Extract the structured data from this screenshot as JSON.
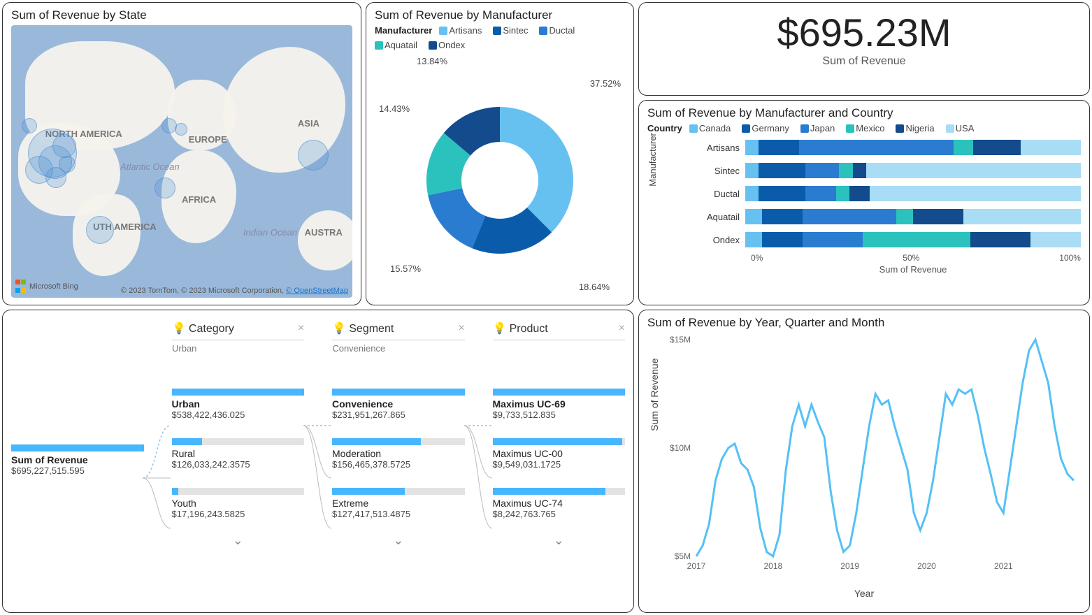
{
  "colors": {
    "c1": "#66c1f0",
    "c2": "#0a5cab",
    "c3": "#2a7cd0",
    "c4": "#2bc2bd",
    "c5": "#134b8c",
    "c6": "#a9dcf5",
    "line": "#55c1f5",
    "bar_bg": "#e3e3e3",
    "bar_fill": "#46b6ff"
  },
  "map": {
    "title": "Sum of Revenue by State",
    "labels": {
      "na": "NORTH AMERICA",
      "sa": "UTH AMERICA",
      "eu": "EUROPE",
      "af": "AFRICA",
      "as": "ASIA",
      "au": "AUSTRA",
      "ao": "Atlantic Ocean",
      "io": "Indian Ocean"
    },
    "attribution_left": "Microsoft Bing",
    "attribution_right": "© 2023 TomTom, © 2023 Microsoft Corporation, ",
    "attribution_link": "© OpenStreetMap"
  },
  "donut": {
    "title": "Sum of Revenue by Manufacturer",
    "legend_label": "Manufacturer",
    "items": [
      "Artisans",
      "Sintec",
      "Ductal",
      "Aquatail",
      "Ondex"
    ],
    "labels": [
      "37.52%",
      "18.64%",
      "15.57%",
      "14.43%",
      "13.84%"
    ]
  },
  "kpi": {
    "value": "$695.23M",
    "label": "Sum of Revenue"
  },
  "hbar": {
    "title": "Sum of Revenue by Manufacturer and Country",
    "legend_label": "Country",
    "countries": [
      "Canada",
      "Germany",
      "Japan",
      "Mexico",
      "Nigeria",
      "USA"
    ],
    "yaxis": "Manufacturer",
    "xlabel": "Sum of Revenue",
    "xticks": [
      "0%",
      "50%",
      "100%"
    ],
    "rows": [
      {
        "name": "Artisans"
      },
      {
        "name": "Sintec"
      },
      {
        "name": "Ductal"
      },
      {
        "name": "Aquatail"
      },
      {
        "name": "Ondex"
      }
    ]
  },
  "decomp": {
    "headers": [
      {
        "title": "Category",
        "sub": "Urban"
      },
      {
        "title": "Segment",
        "sub": "Convenience"
      },
      {
        "title": "Product",
        "sub": ""
      }
    ],
    "root": {
      "name": "Sum of Revenue",
      "value": "$695,227,515.595"
    },
    "col1": [
      {
        "name": "Urban",
        "value": "$538,422,436.025",
        "fill": 100,
        "bold": true
      },
      {
        "name": "Rural",
        "value": "$126,033,242.3575",
        "fill": 23
      },
      {
        "name": "Youth",
        "value": "$17,196,243.5825",
        "fill": 5
      }
    ],
    "col2": [
      {
        "name": "Convenience",
        "value": "$231,951,267.865",
        "fill": 100,
        "bold": true
      },
      {
        "name": "Moderation",
        "value": "$156,465,378.5725",
        "fill": 67
      },
      {
        "name": "Extreme",
        "value": "$127,417,513.4875",
        "fill": 55
      }
    ],
    "col3": [
      {
        "name": "Maximus UC-69",
        "value": "$9,733,512.835",
        "fill": 100,
        "bold": true
      },
      {
        "name": "Maximus UC-00",
        "value": "$9,549,031.1725",
        "fill": 98
      },
      {
        "name": "Maximus UC-74",
        "value": "$8,242,763.765",
        "fill": 85
      }
    ]
  },
  "line": {
    "title": "Sum of Revenue by Year, Quarter and Month",
    "yaxis": "Sum of Revenue",
    "xaxis": "Year",
    "yticks": [
      "$15M",
      "$10M",
      "$5M"
    ],
    "xticks": [
      "2017",
      "2018",
      "2019",
      "2020",
      "2021"
    ]
  },
  "chart_data": [
    {
      "type": "pie",
      "title": "Sum of Revenue by Manufacturer",
      "categories": [
        "Artisans",
        "Sintec",
        "Ductal",
        "Aquatail",
        "Ondex"
      ],
      "values": [
        37.52,
        18.64,
        15.57,
        14.43,
        13.84
      ],
      "unit": "percent"
    },
    {
      "type": "bar",
      "title": "Sum of Revenue by Manufacturer and Country",
      "orientation": "horizontal-stacked-100",
      "categories": [
        "Artisans",
        "Sintec",
        "Ductal",
        "Aquatail",
        "Ondex"
      ],
      "xlabel": "Sum of Revenue",
      "ylabel": "Manufacturer",
      "xticks": [
        0,
        50,
        100
      ],
      "series": [
        {
          "name": "Canada",
          "values": [
            4,
            4,
            4,
            5,
            5
          ]
        },
        {
          "name": "Germany",
          "values": [
            12,
            14,
            14,
            12,
            12
          ]
        },
        {
          "name": "Japan",
          "values": [
            46,
            10,
            9,
            28,
            18
          ]
        },
        {
          "name": "Mexico",
          "values": [
            6,
            4,
            4,
            5,
            32
          ]
        },
        {
          "name": "Nigeria",
          "values": [
            14,
            4,
            6,
            15,
            18
          ]
        },
        {
          "name": "USA",
          "values": [
            18,
            64,
            63,
            35,
            15
          ]
        }
      ]
    },
    {
      "type": "line",
      "title": "Sum of Revenue by Year, Quarter and Month",
      "xlabel": "Year",
      "ylabel": "Sum of Revenue",
      "ylim": [
        5,
        15
      ],
      "y_unit": "$M",
      "x": [
        "2017-01",
        "2017-02",
        "2017-03",
        "2017-04",
        "2017-05",
        "2017-06",
        "2017-07",
        "2017-08",
        "2017-09",
        "2017-10",
        "2017-11",
        "2017-12",
        "2018-01",
        "2018-02",
        "2018-03",
        "2018-04",
        "2018-05",
        "2018-06",
        "2018-07",
        "2018-08",
        "2018-09",
        "2018-10",
        "2018-11",
        "2018-12",
        "2019-01",
        "2019-02",
        "2019-03",
        "2019-04",
        "2019-05",
        "2019-06",
        "2019-07",
        "2019-08",
        "2019-09",
        "2019-10",
        "2019-11",
        "2019-12",
        "2020-01",
        "2020-02",
        "2020-03",
        "2020-04",
        "2020-05",
        "2020-06",
        "2020-07",
        "2020-08",
        "2020-09",
        "2020-10",
        "2020-11",
        "2020-12",
        "2021-01",
        "2021-02",
        "2021-03",
        "2021-04",
        "2021-05",
        "2021-06",
        "2021-07",
        "2021-08",
        "2021-09",
        "2021-10",
        "2021-11",
        "2021-12"
      ],
      "values": [
        5.0,
        5.5,
        6.5,
        8.5,
        9.5,
        10.0,
        10.2,
        9.3,
        9.0,
        8.2,
        6.3,
        5.2,
        5.0,
        6.0,
        9.0,
        11.0,
        12.0,
        11.0,
        12.0,
        11.2,
        10.5,
        8.0,
        6.2,
        5.2,
        5.5,
        7.0,
        9.0,
        11.0,
        12.5,
        12.0,
        12.2,
        11.0,
        10.0,
        9.0,
        7.0,
        6.2,
        7.0,
        8.5,
        10.5,
        12.5,
        12.0,
        12.7,
        12.5,
        12.7,
        11.5,
        10.0,
        8.8,
        7.5,
        7.0,
        9.0,
        11.0,
        13.0,
        14.5,
        15.0,
        14.0,
        13.0,
        11.0,
        9.5,
        8.8,
        8.5
      ]
    },
    {
      "type": "table",
      "title": "Decomposition Tree",
      "root": {
        "label": "Sum of Revenue",
        "value": 695227515.595
      },
      "levels": [
        {
          "name": "Category",
          "selected": "Urban",
          "items": [
            {
              "label": "Urban",
              "value": 538422436.025
            },
            {
              "label": "Rural",
              "value": 126033242.3575
            },
            {
              "label": "Youth",
              "value": 17196243.5825
            }
          ]
        },
        {
          "name": "Segment",
          "selected": "Convenience",
          "items": [
            {
              "label": "Convenience",
              "value": 231951267.865
            },
            {
              "label": "Moderation",
              "value": 156465378.5725
            },
            {
              "label": "Extreme",
              "value": 127417513.4875
            }
          ]
        },
        {
          "name": "Product",
          "selected": "Maximus UC-69",
          "items": [
            {
              "label": "Maximus UC-69",
              "value": 9733512.835
            },
            {
              "label": "Maximus UC-00",
              "value": 9549031.1725
            },
            {
              "label": "Maximus UC-74",
              "value": 8242763.765
            }
          ]
        }
      ]
    },
    {
      "type": "card",
      "title": "Sum of Revenue",
      "value": 695230000,
      "formatted": "$695.23M"
    }
  ]
}
